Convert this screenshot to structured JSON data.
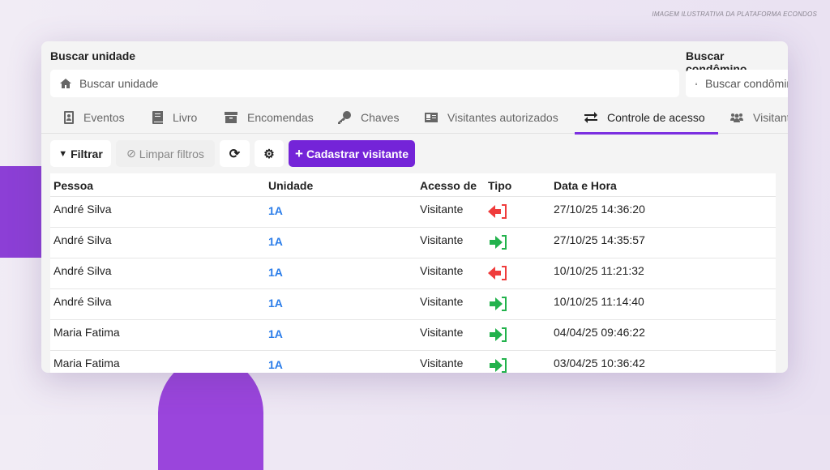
{
  "watermark": "IMAGEM ILUSTRATIVA DA PLATAFORMA ECONDOS",
  "search_unit": {
    "label": "Buscar unidade",
    "placeholder": "Buscar unidade",
    "icon": "home-icon"
  },
  "search_resident": {
    "label": "Buscar condômino",
    "placeholder": "Buscar condômino",
    "icon": "user-icon"
  },
  "tabs": [
    {
      "label": "Eventos",
      "icon": "id-badge-icon"
    },
    {
      "label": "Livro",
      "icon": "book-icon"
    },
    {
      "label": "Encomendas",
      "icon": "archive-icon"
    },
    {
      "label": "Chaves",
      "icon": "key-icon"
    },
    {
      "label": "Visitantes autorizados",
      "icon": "id-card-icon"
    },
    {
      "label": "Controle de acesso",
      "icon": "exchange-icon",
      "active": true
    },
    {
      "label": "Visitantes",
      "icon": "users-icon"
    }
  ],
  "toolbar": {
    "filter": "Filtrar",
    "clear": "Limpar filtros",
    "register": "Cadastrar visitante"
  },
  "colors": {
    "accent": "#7424d8",
    "exit": "#ef3b3b",
    "entry": "#22b24c",
    "link": "#2b7de9"
  },
  "table": {
    "columns": [
      "Pessoa",
      "Unidade",
      "Acesso de",
      "Tipo",
      "Data e Hora"
    ],
    "rows": [
      {
        "person": "André Silva",
        "unit": "1A",
        "access": "Visitante",
        "type": "exit",
        "datetime": "27/10/25 14:36:20"
      },
      {
        "person": "André Silva",
        "unit": "1A",
        "access": "Visitante",
        "type": "entry",
        "datetime": "27/10/25 14:35:57"
      },
      {
        "person": "André Silva",
        "unit": "1A",
        "access": "Visitante",
        "type": "exit",
        "datetime": "10/10/25 11:21:32"
      },
      {
        "person": "André Silva",
        "unit": "1A",
        "access": "Visitante",
        "type": "entry",
        "datetime": "10/10/25 11:14:40"
      },
      {
        "person": "Maria Fatima",
        "unit": "1A",
        "access": "Visitante",
        "type": "entry",
        "datetime": "04/04/25 09:46:22"
      },
      {
        "person": "Maria Fatima",
        "unit": "1A",
        "access": "Visitante",
        "type": "entry",
        "datetime": "03/04/25 10:36:42"
      }
    ]
  }
}
